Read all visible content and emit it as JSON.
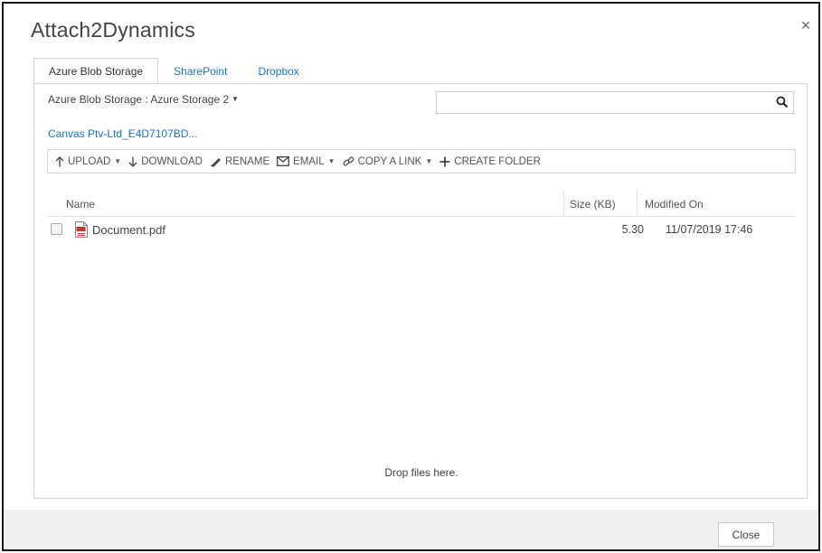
{
  "dialog": {
    "title": "Attach2Dynamics",
    "close_glyph": "×"
  },
  "tabs": [
    {
      "label": "Azure Blob Storage",
      "active": true
    },
    {
      "label": "SharePoint",
      "active": false
    },
    {
      "label": "Dropbox",
      "active": false
    }
  ],
  "storage": {
    "selected": "Azure Blob Storage : Azure Storage 2",
    "caret": "▼"
  },
  "search": {
    "value": "",
    "placeholder": "",
    "icon": "search-icon"
  },
  "breadcrumb": {
    "label": "Canvas Ptv-Ltd_E4D7107BD..."
  },
  "toolbar": {
    "upload": "UPLOAD",
    "download": "DOWNLOAD",
    "rename": "RENAME",
    "email": "EMAIL",
    "copy_link": "COPY A LINK",
    "create_folder": "CREATE FOLDER",
    "caret": "▼"
  },
  "columns": {
    "name": "Name",
    "size": "Size (KB)",
    "modified": "Modified On"
  },
  "files": [
    {
      "name": "Document.pdf",
      "size": "5.30",
      "modified": "11/07/2019 17:46",
      "icon": "pdf-file-icon"
    }
  ],
  "drop_zone": {
    "text": "Drop files here."
  },
  "footer": {
    "close_label": "Close"
  },
  "colors": {
    "link": "#1976c2",
    "border": "#d5d5d5",
    "footer_bg": "#f0f0f0",
    "pdf_red": "#c0392b"
  }
}
